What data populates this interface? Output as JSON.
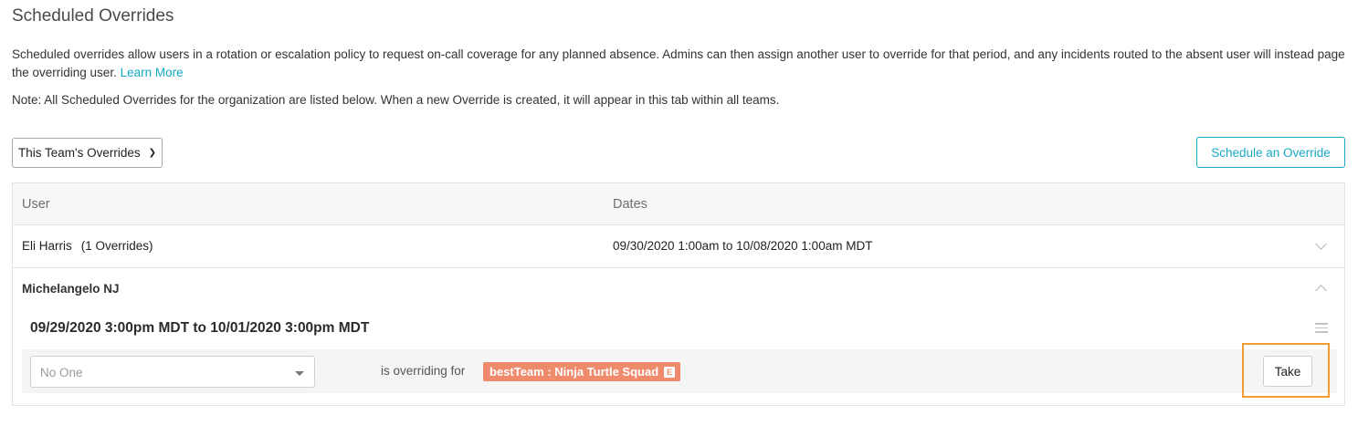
{
  "page": {
    "title": "Scheduled Overrides",
    "description": "Scheduled overrides allow users in a rotation or escalation policy to request on-call coverage for any planned absence. Admins can then assign another user to override for that period, and any incidents routed to the absent user will instead page the overriding user.",
    "learn_more": "Learn More",
    "note": "Note: All Scheduled Overrides for the organization are listed below. When a new Override is created, it will appear in this tab within all teams."
  },
  "toolbar": {
    "filter_value": "This Team's Overrides",
    "schedule_button": "Schedule an Override"
  },
  "table": {
    "headers": {
      "user": "User",
      "dates": "Dates"
    },
    "rows": [
      {
        "user": "Eli Harris",
        "count": "(1 Overrides)",
        "dates": "09/30/2020 1:00am to 10/08/2020 1:00am MDT",
        "expanded": false
      }
    ],
    "expanded_group": {
      "user": "Michelangelo NJ",
      "range": "09/29/2020 3:00pm MDT to 10/01/2020 3:00pm MDT",
      "assignee_placeholder": "No One",
      "overriding_for": "is overriding for",
      "team_badge": "bestTeam : Ninja Turtle Squad",
      "badge_tag": "E",
      "take_button": "Take"
    }
  },
  "colors": {
    "accent": "#19a9c6",
    "badge": "#ef8a6c",
    "highlight": "#f29b30"
  }
}
